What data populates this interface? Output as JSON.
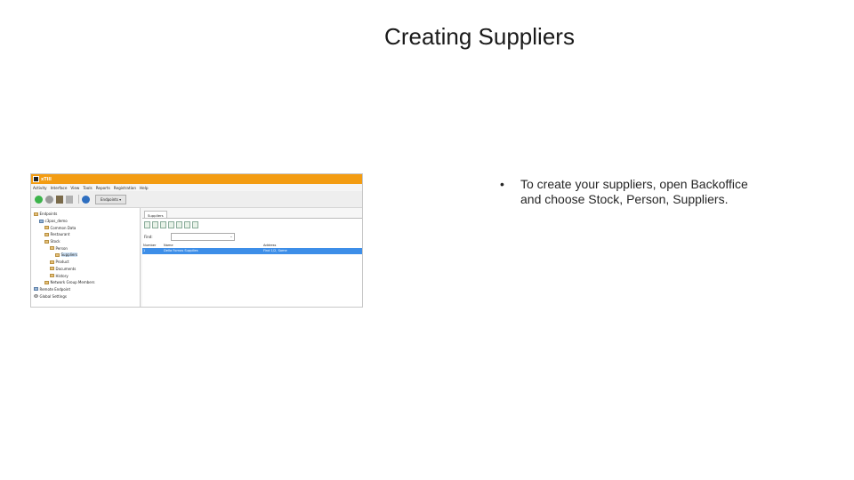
{
  "slide": {
    "title": "Creating Suppliers",
    "bullet_marker": "•",
    "bullet_text": "To create your suppliers, open Backoffice and choose Stock, Person, Suppliers."
  },
  "app": {
    "window_title": "xTill",
    "menu": [
      "Activity",
      "Interface",
      "View",
      "Tools",
      "Reports",
      "Registration",
      "Help"
    ],
    "toolbar": {
      "endpoint_button": "Endpoints ▾"
    },
    "tree": [
      {
        "label": "Endpoints",
        "indent": 0
      },
      {
        "label": "c3pos_demo",
        "indent": 1
      },
      {
        "label": "Common Data",
        "indent": 2
      },
      {
        "label": "Restaurant",
        "indent": 2
      },
      {
        "label": "Stock",
        "indent": 2
      },
      {
        "label": "Person",
        "indent": 3
      },
      {
        "label": "Suppliers",
        "indent": 4
      },
      {
        "label": "Product",
        "indent": 3
      },
      {
        "label": "Documents",
        "indent": 3
      },
      {
        "label": "History",
        "indent": 3
      },
      {
        "label": "Network Group Members",
        "indent": 2
      },
      {
        "label": "Remote Endpoint",
        "indent": 0
      },
      {
        "label": "Global Settings",
        "indent": 0
      }
    ],
    "tab_label": "Suppliers",
    "find_label": "Find:",
    "grid": {
      "headers": [
        "Number",
        "Name",
        "Address"
      ],
      "rows": [
        [
          "1",
          "Della Fornos Supplies",
          "Find 1/2, Some"
        ]
      ]
    },
    "colors": {
      "titlebar": "#f39c12",
      "selection": "#3d8ee8"
    }
  }
}
